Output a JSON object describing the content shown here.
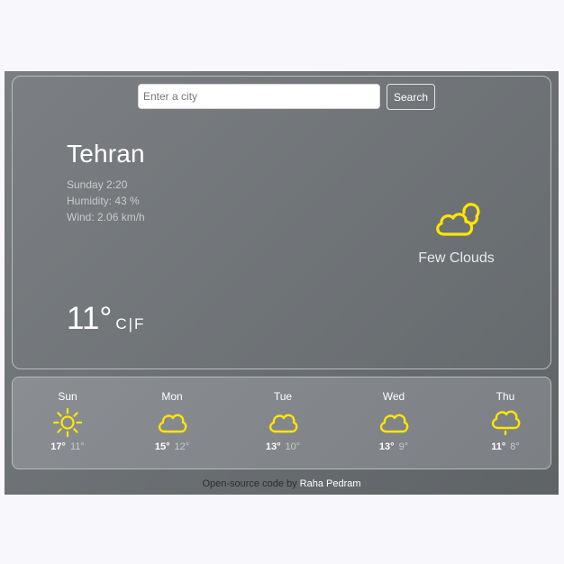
{
  "search": {
    "placeholder": "Enter a city",
    "value": "",
    "button_label": "Search"
  },
  "current": {
    "city": "Tehran",
    "datetime": "Sunday 2:20",
    "humidity": "Humidity: 43 %",
    "wind": "Wind: 2.06 km/h",
    "temperature": "11°",
    "unit_c": "C",
    "unit_separator": "|",
    "unit_f": "F",
    "condition": "Few Clouds",
    "condition_icon": "partly-cloudy-icon"
  },
  "forecast": [
    {
      "day": "Sun",
      "max": "17°",
      "min": "11°",
      "icon": "sun-icon"
    },
    {
      "day": "Mon",
      "max": "15°",
      "min": "12°",
      "icon": "cloud-icon"
    },
    {
      "day": "Tue",
      "max": "13°",
      "min": "10°",
      "icon": "cloud-icon"
    },
    {
      "day": "Wed",
      "max": "13°",
      "min": "9°",
      "icon": "cloud-icon"
    },
    {
      "day": "Thu",
      "max": "11°",
      "min": "8°",
      "icon": "drizzle-icon"
    }
  ],
  "footer": {
    "prefix": "Open-source code by",
    "author": "Raha Pedram"
  },
  "colors": {
    "icon": "#ffe600",
    "background": "#6c7174"
  }
}
